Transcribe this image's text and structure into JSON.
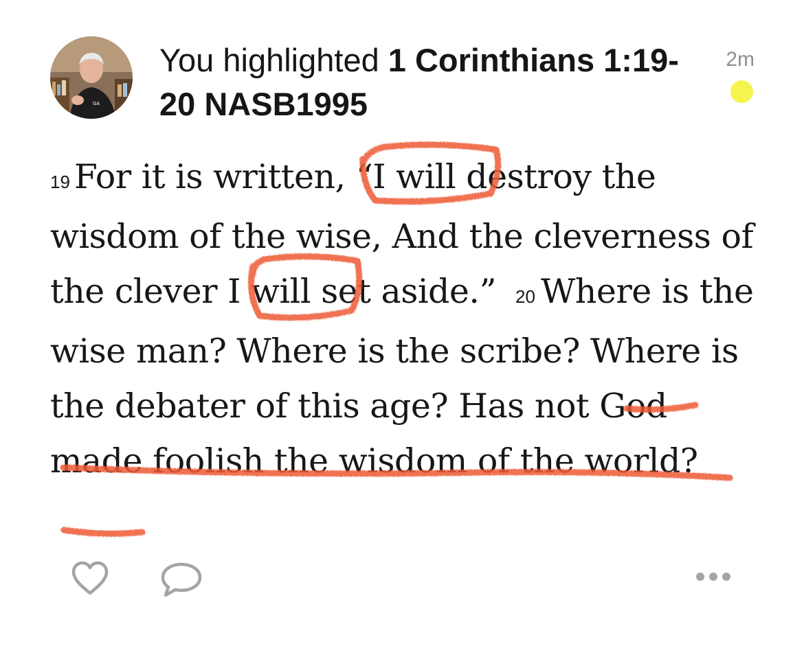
{
  "header": {
    "prefix": "You highlighted ",
    "reference": "1 Corinthians 1:19-20 NASB1995",
    "time": "2m",
    "highlight_color": "#F5F44F"
  },
  "verse": {
    "num_19": "19",
    "text_19": "For it is written, “I will destroy the wisdom of the wise, And the cleverness of the clever I will set aside.”",
    "num_20": "20",
    "text_20_a": "Where is the wise man? Where is the scribe? Where is the debater of this age? ",
    "text_20_b": "Has not God made foolish the wisdom of the world?"
  },
  "annotation": {
    "color": "#EE5A36"
  },
  "actions": {
    "icons": [
      "heart-icon",
      "comment-icon",
      "more-icon"
    ]
  }
}
